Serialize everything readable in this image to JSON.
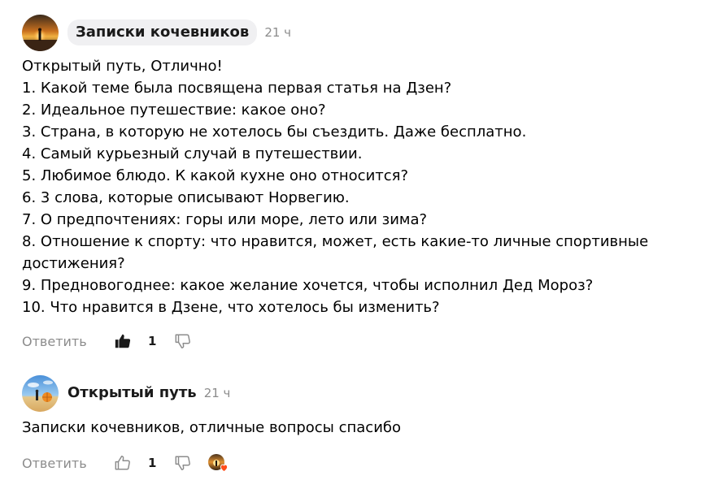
{
  "comments": [
    {
      "author": "Записки кочевников",
      "time": "21 ч",
      "text": "Открытый путь, Отлично!\n1. Какой теме была посвящена первая статья на Дзен?\n2. Идеальное путешествие: какое оно?\n3. Страна, в которую не хотелось бы съездить. Даже бесплатно.\n4. Самый курьезный случай в путешествии.\n5. Любимое блюдо. К какой кухне оно относится?\n6. 3 слова, которые описывают Норвегию.\n7. О предпочтениях: горы или море, лето или зима?\n8. Отношение к спорту: что нравится, может, есть какие-то личные спортивные\nдостижения?\n9. Предновогоднее: какое желание хочется, чтобы исполнил Дед Мороз?\n10. Что нравится в Дзене, что хотелось бы изменить?",
      "reply_label": "Ответить",
      "likes": "1",
      "liked": true
    },
    {
      "author": "Открытый путь",
      "time": "21 ч",
      "text": "Записки кочевников, отличные вопросы спасибо",
      "reply_label": "Ответить",
      "likes": "1",
      "liked": false,
      "author_liked": true
    }
  ],
  "colors": {
    "muted": "#8c8c8c",
    "chip_bg": "#f0f0f2",
    "like_active": "#1a1a1a",
    "heart": "#ff4d1a"
  },
  "icons": {
    "like": "thumbs-up-icon",
    "dislike": "thumbs-down-icon",
    "author_heart": "heart-icon"
  }
}
